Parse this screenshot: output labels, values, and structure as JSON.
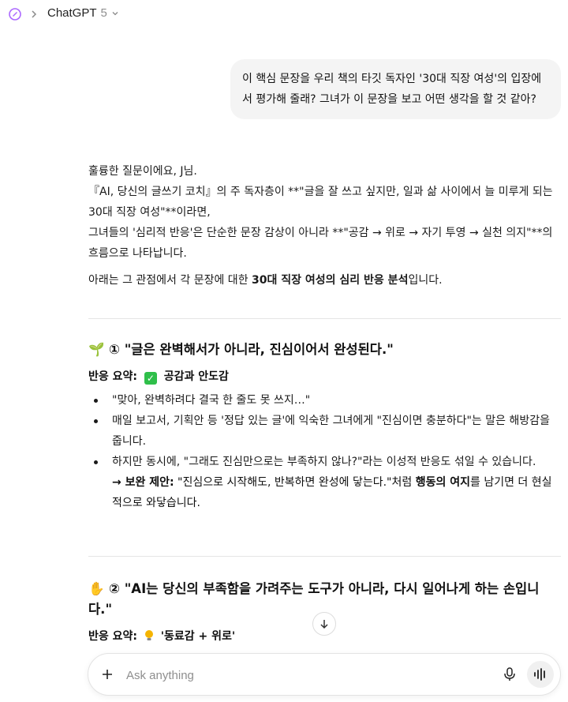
{
  "header": {
    "title": "ChatGPT",
    "version": "5"
  },
  "user_message": "이 핵심 문장을 우리 책의 타깃 독자인 '30대 직장 여성'의 입장에서 평가해 줄래? 그녀가 이 문장을 보고 어떤 생각을 할 것 같아?",
  "assistant": {
    "intro_1": "훌륭한 질문이에요, J님.",
    "intro_2": "『AI, 당신의 글쓰기 코치』의 주 독자층이 **\"글을 잘 쓰고 싶지만, 일과 삶 사이에서 늘 미루게 되는 30대 직장 여성\"**이라면,",
    "intro_3": "그녀들의 '심리적 반응'은 단순한 문장 감상이 아니라 **\"공감 → 위로 → 자기 투영 → 실천 의지\"**의 흐름으로 나타납니다.",
    "intro_4_pre": "아래는 그 관점에서 각 문장에 대한 ",
    "intro_4_bold": "30대 직장 여성의 심리 반응 분석",
    "intro_4_post": "입니다.",
    "section1": {
      "emoji": "🌱",
      "heading": "① \"글은 완벽해서가 아니라, 진심이어서 완성된다.\"",
      "summary_label": "반응 요약:",
      "summary_value": "공감과 안도감",
      "bullet1": "\"맞아, 완벽하려다 결국 한 줄도 못 쓰지…\"",
      "bullet2": "매일 보고서, 기획안 등 '정답 있는 글'에 익숙한 그녀에게 \"진심이면 충분하다\"는 말은 해방감을 줍니다.",
      "bullet3": "하지만 동시에, \"그래도 진심만으로는 부족하지 않나?\"라는 이성적 반응도 섞일 수 있습니다.",
      "suggest_label": "→ 보완 제안:",
      "suggest_text_1": " \"진심으로 시작해도, 반복하면 완성에 닿는다.\"처럼 ",
      "suggest_bold": "행동의 여지",
      "suggest_text_2": "를 남기면 더 현실적으로 와닿습니다."
    },
    "section2": {
      "emoji": "✋",
      "heading": "② \"AI는 당신의 부족함을 가려주는 도구가 아니라, 다시 일어나게 하는 손입니다.\"",
      "summary_label": "반응 요약:",
      "summary_value": "'동료감 + 위로'"
    }
  },
  "composer": {
    "placeholder": "Ask anything"
  },
  "icons": {
    "logo": "chatgpt-logo-icon",
    "chevron": "chevron-right-icon",
    "caret": "chevron-down-icon",
    "scroll": "arrow-down-icon",
    "plus": "plus-icon",
    "mic": "microphone-icon",
    "voice": "voice-waveform-icon"
  },
  "colors": {
    "accent": "#ab68ff",
    "check": "#2fbf4a",
    "bulb": "#f5b400"
  }
}
